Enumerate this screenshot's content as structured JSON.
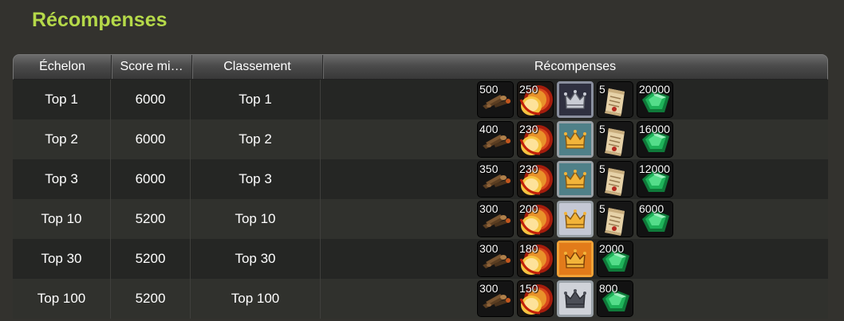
{
  "title": "Récompenses",
  "headers": {
    "tier": "Échelon",
    "min_score": "Score mi…",
    "rank": "Classement",
    "rewards": "Récompenses"
  },
  "colors": {
    "title": "#b5d949",
    "crown_gold": "#f2b43a",
    "crown_silver": "#c9ccd4",
    "gem": "#1fb35a"
  },
  "rows": [
    {
      "tier": "Top 1",
      "min_score": "6000",
      "rank": "Top 1",
      "rewards": [
        {
          "icon": "wood-log-icon",
          "count": "500"
        },
        {
          "icon": "gold-coin-icon",
          "count": "250"
        },
        {
          "icon": "silver-crown-dark-icon",
          "count": ""
        },
        {
          "icon": "scroll-icon",
          "count": "5"
        },
        {
          "icon": "green-gem-icon",
          "count": "20000"
        }
      ]
    },
    {
      "tier": "Top 2",
      "min_score": "6000",
      "rank": "Top 2",
      "rewards": [
        {
          "icon": "wood-log-icon",
          "count": "400"
        },
        {
          "icon": "gold-coin-icon",
          "count": "230"
        },
        {
          "icon": "gold-crown-teal-icon",
          "count": ""
        },
        {
          "icon": "scroll-icon",
          "count": "5"
        },
        {
          "icon": "green-gem-icon",
          "count": "16000"
        }
      ]
    },
    {
      "tier": "Top 3",
      "min_score": "6000",
      "rank": "Top 3",
      "rewards": [
        {
          "icon": "wood-log-icon",
          "count": "350"
        },
        {
          "icon": "gold-coin-icon",
          "count": "230"
        },
        {
          "icon": "gold-crown-teal-icon",
          "count": ""
        },
        {
          "icon": "scroll-icon",
          "count": "5"
        },
        {
          "icon": "green-gem-icon",
          "count": "12000"
        }
      ]
    },
    {
      "tier": "Top 10",
      "min_score": "5200",
      "rank": "Top 10",
      "rewards": [
        {
          "icon": "wood-log-icon",
          "count": "300"
        },
        {
          "icon": "gold-coin-icon",
          "count": "200"
        },
        {
          "icon": "gold-crown-silver-icon",
          "count": ""
        },
        {
          "icon": "scroll-icon",
          "count": "5"
        },
        {
          "icon": "green-gem-icon",
          "count": "6000"
        }
      ]
    },
    {
      "tier": "Top 30",
      "min_score": "5200",
      "rank": "Top 30",
      "rewards": [
        {
          "icon": "wood-log-icon",
          "count": "300"
        },
        {
          "icon": "gold-coin-icon",
          "count": "180"
        },
        {
          "icon": "gold-crown-orange-icon",
          "count": ""
        },
        {
          "icon": "green-gem-icon",
          "count": "2000"
        }
      ]
    },
    {
      "tier": "Top 100",
      "min_score": "5200",
      "rank": "Top 100",
      "rewards": [
        {
          "icon": "wood-log-icon",
          "count": "300"
        },
        {
          "icon": "gold-coin-icon",
          "count": "150"
        },
        {
          "icon": "silver-crown-light-icon",
          "count": ""
        },
        {
          "icon": "green-gem-icon",
          "count": "800"
        }
      ]
    }
  ]
}
